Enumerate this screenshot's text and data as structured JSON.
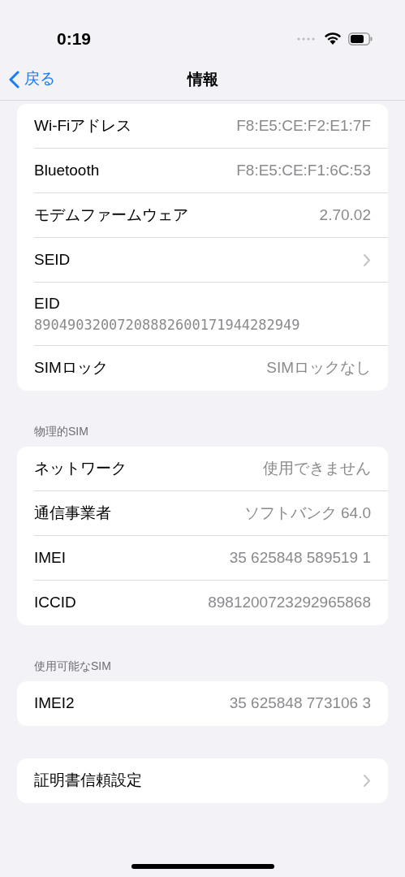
{
  "status_bar": {
    "time": "0:19"
  },
  "nav": {
    "back": "戻る",
    "title": "情報"
  },
  "groups": [
    {
      "rows": [
        {
          "kind": "value",
          "label": "Wi-Fiアドレス",
          "value": "F8:E5:CE:F2:E1:7F"
        },
        {
          "kind": "value",
          "label": "Bluetooth",
          "value": "F8:E5:CE:F1:6C:53"
        },
        {
          "kind": "value",
          "label": "モデムファームウェア",
          "value": "2.70.02"
        },
        {
          "kind": "chevron",
          "label": "SEID"
        },
        {
          "kind": "stacked",
          "label": "EID",
          "value": "89049032007208882600171944282949"
        },
        {
          "kind": "value",
          "label": "SIMロック",
          "value": "SIMロックなし"
        }
      ]
    },
    {
      "header": "物理的SIM",
      "rows": [
        {
          "kind": "value",
          "label": "ネットワーク",
          "value": "使用できません"
        },
        {
          "kind": "value",
          "label": "通信事業者",
          "value": "ソフトバンク 64.0"
        },
        {
          "kind": "value",
          "label": "IMEI",
          "value": "35 625848 589519 1"
        },
        {
          "kind": "value",
          "label": "ICCID",
          "value": "8981200723292965868"
        }
      ]
    },
    {
      "header": "使用可能なSIM",
      "rows": [
        {
          "kind": "value",
          "label": "IMEI2",
          "value": "35 625848 773106 3"
        }
      ]
    },
    {
      "rows": [
        {
          "kind": "chevron",
          "label": "証明書信頼設定"
        }
      ]
    }
  ]
}
